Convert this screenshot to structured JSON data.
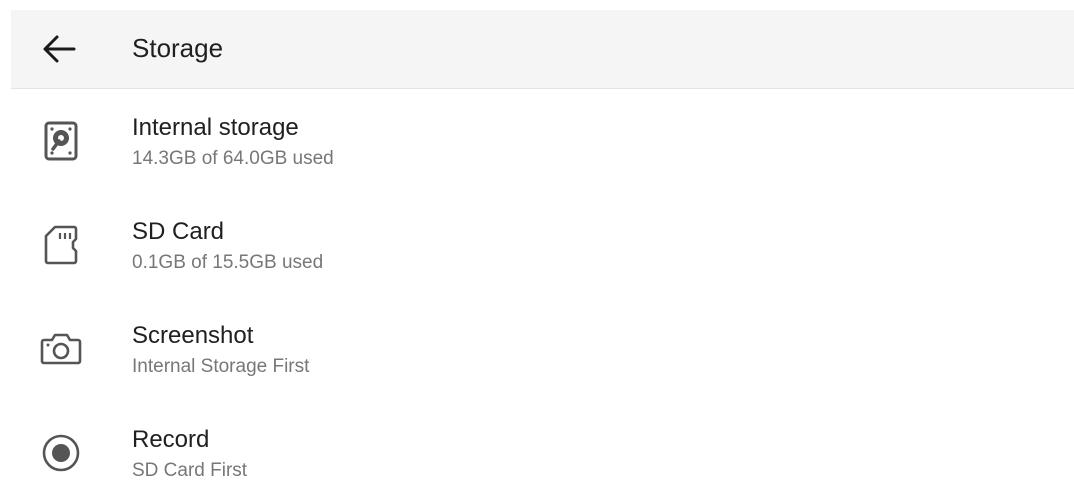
{
  "header": {
    "back_icon": "arrow-left-icon",
    "title": "Storage"
  },
  "items": [
    {
      "icon": "hard-drive-icon",
      "title": "Internal storage",
      "subtitle": "14.3GB of 64.0GB used"
    },
    {
      "icon": "sd-card-icon",
      "title": "SD Card",
      "subtitle": "0.1GB of 15.5GB used"
    },
    {
      "icon": "camera-icon",
      "title": "Screenshot",
      "subtitle": "Internal Storage First"
    },
    {
      "icon": "record-icon",
      "title": "Record",
      "subtitle": "SD Card First"
    }
  ],
  "colors": {
    "header_bg": "#f5f5f5",
    "text_primary": "#202020",
    "text_secondary": "#777777",
    "icon": "#555555"
  }
}
